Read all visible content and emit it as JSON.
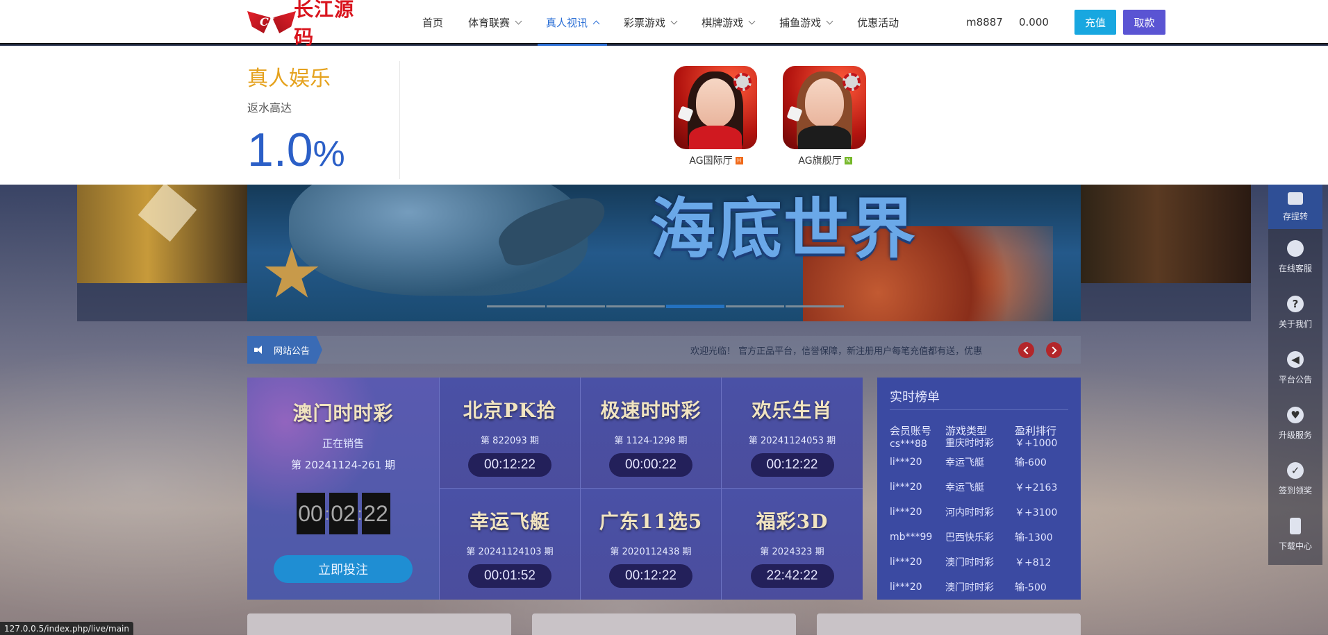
{
  "header": {
    "logo_text": "长江源码",
    "logo_mark": "CJ",
    "nav": [
      {
        "label": "首页",
        "has_chevron": false,
        "active": false
      },
      {
        "label": "体育联赛",
        "has_chevron": true,
        "active": false
      },
      {
        "label": "真人视讯",
        "has_chevron": true,
        "active": true
      },
      {
        "label": "彩票游戏",
        "has_chevron": true,
        "active": false
      },
      {
        "label": "棋牌游戏",
        "has_chevron": true,
        "active": false
      },
      {
        "label": "捕鱼游戏",
        "has_chevron": true,
        "active": false
      },
      {
        "label": "优惠活动",
        "has_chevron": false,
        "active": false
      }
    ],
    "username": "m8887",
    "balance": "0.000",
    "recharge_label": "充值",
    "withdraw_label": "取款"
  },
  "dropdown": {
    "title": "真人娱乐",
    "subtitle": "返水高达",
    "rate_value": "1.0",
    "rate_unit": "%",
    "games": [
      {
        "name": "AG国际厅",
        "badge": "H"
      },
      {
        "name": "AG旗舰厅",
        "badge": "N"
      }
    ]
  },
  "banner": {
    "title": "海底世界",
    "slides_total": 6,
    "active_slide": 4
  },
  "notice": {
    "label": "网站公告",
    "text": "欢迎光临！ 官方正品平台，信誉保障，新注册用户每笔充值都有送，优惠"
  },
  "lottery": {
    "main": {
      "name": "澳门时时彩",
      "status": "正在销售",
      "period": "第 20241124-261 期",
      "countdown": [
        "00",
        "02",
        "22"
      ],
      "bet_label": "立即投注"
    },
    "cells": [
      {
        "name": "北京PK拾",
        "period": "第 822093 期",
        "timer": "00:12:22"
      },
      {
        "name": "极速时时彩",
        "period": "第 1124-1298 期",
        "timer": "00:00:22"
      },
      {
        "name": "欢乐生肖",
        "period": "第 20241124053 期",
        "timer": "00:12:22"
      },
      {
        "name": "幸运飞艇",
        "period": "第 20241124103 期",
        "timer": "00:01:52"
      },
      {
        "name": "广东11选5",
        "period": "第 2020112438 期",
        "timer": "00:12:22"
      },
      {
        "name": "福彩3D",
        "period": "第 2024323 期",
        "timer": "22:42:22"
      }
    ]
  },
  "ranking": {
    "title": "实时榜单",
    "headers": [
      "会员账号",
      "游戏类型",
      "盈利排行"
    ],
    "rows": [
      [
        "cs***88",
        "重庆时时彩",
        "￥+1000"
      ],
      [
        "li***20",
        "幸运飞艇",
        "输-600"
      ],
      [
        "li***20",
        "幸运飞艇",
        "￥+2163"
      ],
      [
        "li***20",
        "河内时时彩",
        "￥+3100"
      ],
      [
        "mb***99",
        "巴西快乐彩",
        "输-1300"
      ],
      [
        "li***20",
        "澳门时时彩",
        "￥+812"
      ],
      [
        "li***20",
        "澳门时时彩",
        "输-500"
      ]
    ]
  },
  "sidebar": [
    {
      "label": "存提转",
      "icon": "wallet-icon"
    },
    {
      "label": "在线客服",
      "icon": "headset-icon"
    },
    {
      "label": "关于我们",
      "icon": "question-icon"
    },
    {
      "label": "平台公告",
      "icon": "speaker-icon"
    },
    {
      "label": "升级服务",
      "icon": "heartbeat-icon"
    },
    {
      "label": "签到领奖",
      "icon": "check-icon"
    },
    {
      "label": "下载中心",
      "icon": "phone-icon"
    }
  ],
  "status_url": "127.0.0.5/index.php/live/main",
  "colors": {
    "accent_blue": "#2b6fd6",
    "recharge": "#18a7e0",
    "withdraw": "#5a54d3",
    "dropdown_title": "#e5a21e",
    "rate": "#2b5fc7",
    "brand_red": "#d9141d"
  }
}
